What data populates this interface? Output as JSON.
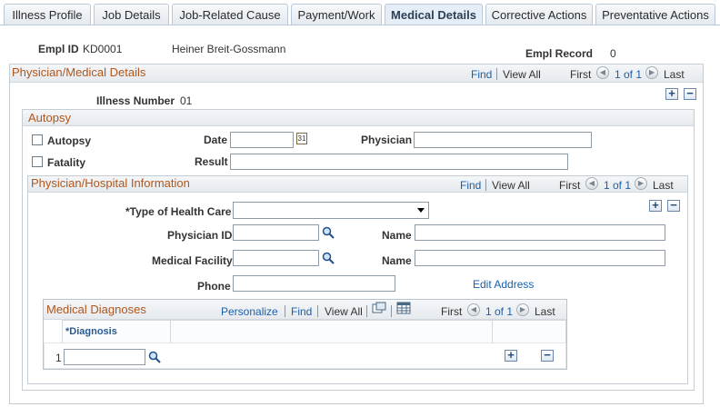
{
  "tabs": [
    {
      "label": "Illness Profile",
      "underline": "P"
    },
    {
      "label": "Job Details"
    },
    {
      "label": "Job-Related Cause"
    },
    {
      "label": "Payment/Work"
    },
    {
      "label": "Medical Details"
    },
    {
      "label": "Corrective Actions"
    },
    {
      "label": "Preventative Actions"
    }
  ],
  "employee": {
    "emplid_label": "Empl ID",
    "emplid_value": "KD0001",
    "name": "Heiner Breit-Gossmann",
    "record_label": "Empl Record",
    "record_value": "0"
  },
  "physician_section": {
    "title": "Physician/Medical Details",
    "find": "Find",
    "view_all": "View All",
    "first": "First",
    "pager": "1 of 1",
    "last": "Last",
    "illness_number_label": "Illness Number",
    "illness_number_value": "01"
  },
  "autopsy_section": {
    "title": "Autopsy",
    "autopsy_label": "Autopsy",
    "fatality_label": "Fatality",
    "date_label": "Date",
    "result_label": "Result",
    "physician_label": "Physician",
    "date_value": "",
    "result_value": "",
    "physician_value": ""
  },
  "hospital_section": {
    "title": "Physician/Hospital Information",
    "find": "Find",
    "view_all": "View All",
    "first": "First",
    "pager": "1 of 1",
    "last": "Last",
    "health_care_label": "*Type of Health Care",
    "health_care_value": "",
    "physician_id_label": "Physician ID",
    "medical_facility_label": "Medical Facility",
    "name_label_1": "Name",
    "name_label_2": "Name",
    "phone_label": "Phone",
    "edit_address": "Edit Address"
  },
  "diagnoses": {
    "title": "Medical Diagnoses",
    "personalize": "Personalize",
    "find": "Find",
    "view_all": "View All",
    "first": "First",
    "pager": "1 of 1",
    "last": "Last",
    "column_header": "*Diagnosis",
    "rows": [
      {
        "num": "1",
        "value": ""
      }
    ]
  },
  "icons": {
    "plus": "+",
    "minus": "−",
    "calendar": "31",
    "prev_arrow": "◀",
    "next_arrow": "▶"
  }
}
